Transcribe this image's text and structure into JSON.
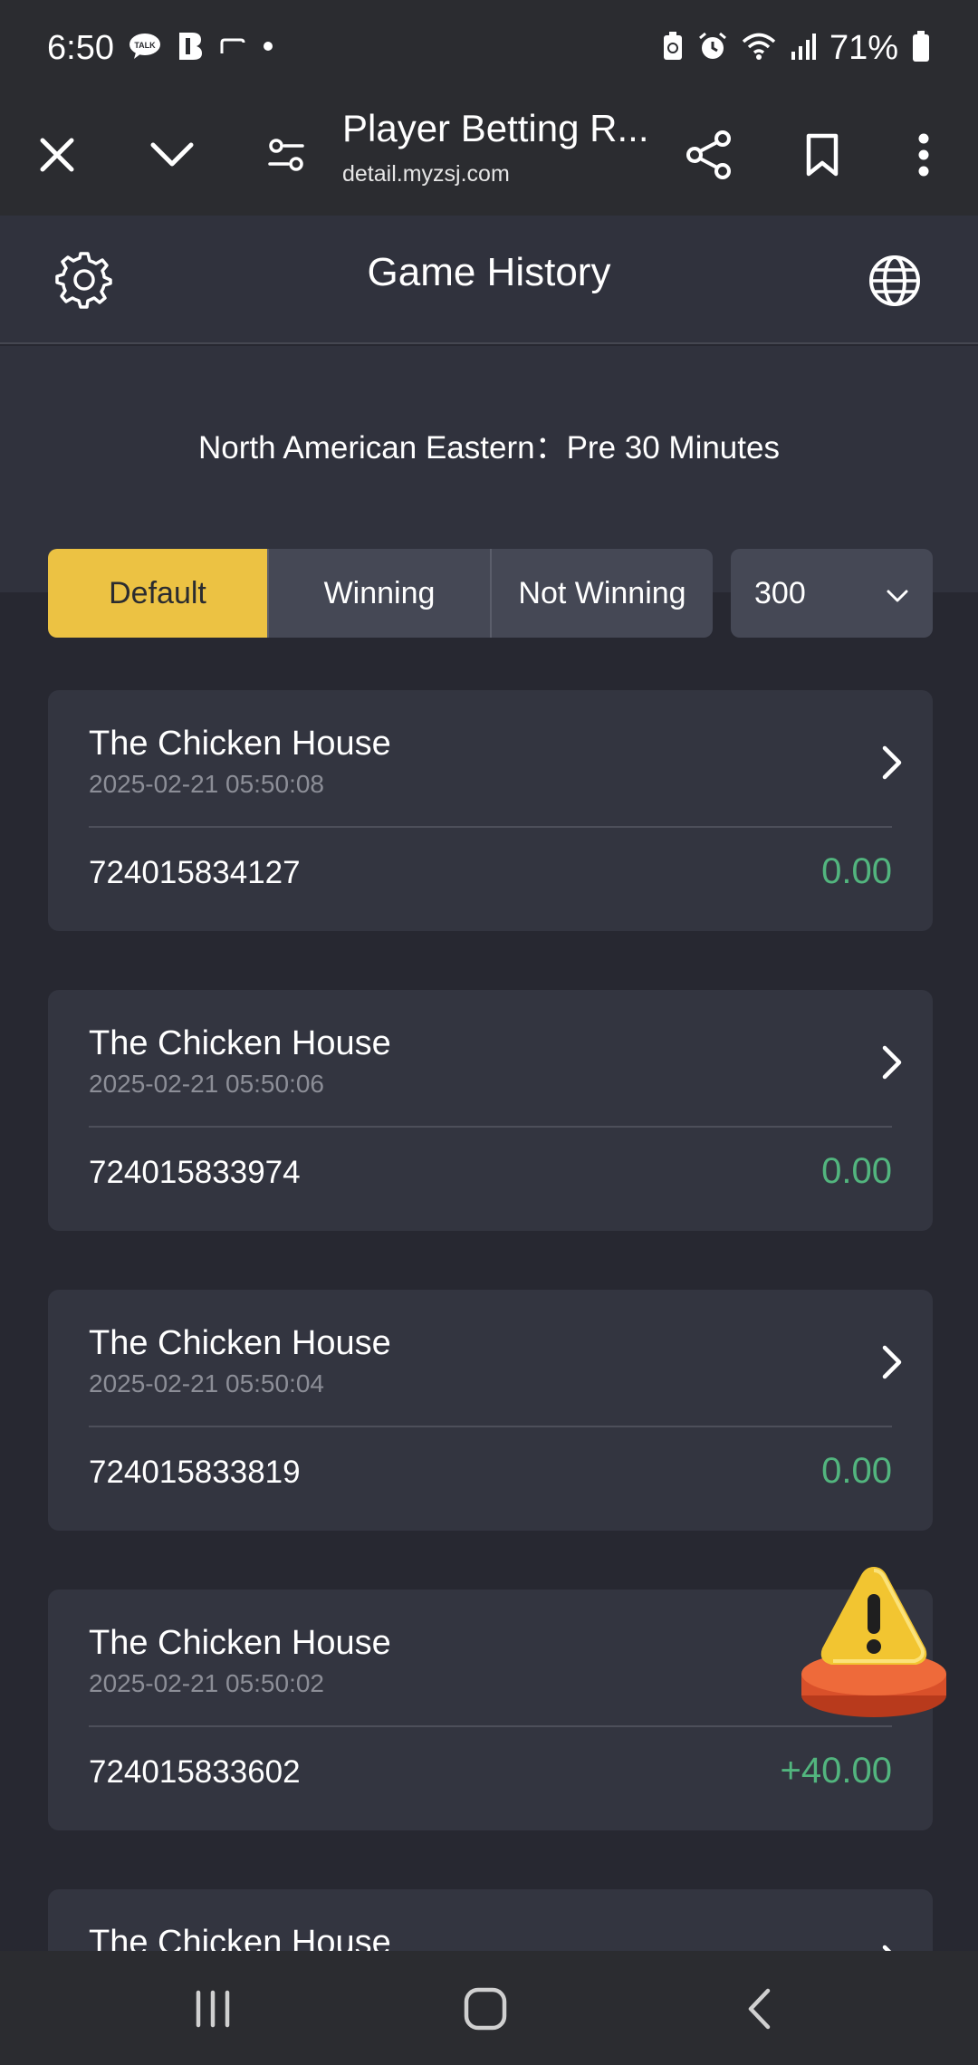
{
  "status_bar": {
    "time": "6:50",
    "battery": "71%",
    "icons": [
      "talk-icon",
      "b-app-icon",
      "cast-icon",
      "dot-icon",
      "battery-saver-icon",
      "alarm-icon",
      "wifi-icon",
      "signal-icon",
      "battery-icon"
    ]
  },
  "browser": {
    "title": "Player Betting R...",
    "url": "detail.myzsj.com",
    "icons": [
      "close-icon",
      "chevron-down-icon",
      "tune-icon",
      "share-icon",
      "bookmark-icon",
      "more-vert-icon"
    ]
  },
  "header": {
    "title": "Game History",
    "icons": [
      "gear-icon",
      "globe-icon"
    ]
  },
  "filter": {
    "timezone": "North American Eastern：Pre 30 Minutes",
    "tabs": [
      {
        "label": "Default",
        "active": true
      },
      {
        "label": "Winning",
        "active": false
      },
      {
        "label": "Not Winning",
        "active": false
      }
    ],
    "count_select": "300"
  },
  "records": [
    {
      "game": "The Chicken House",
      "time": "2025-02-21 05:50:08",
      "id": "724015834127",
      "amount": "0.00"
    },
    {
      "game": "The Chicken House",
      "time": "2025-02-21 05:50:06",
      "id": "724015833974",
      "amount": "0.00"
    },
    {
      "game": "The Chicken House",
      "time": "2025-02-21 05:50:04",
      "id": "724015833819",
      "amount": "0.00"
    },
    {
      "game": "The Chicken House",
      "time": "2025-02-21 05:50:02",
      "id": "724015833602",
      "amount": "+40.00"
    },
    {
      "game": "The Chicken House",
      "time": "",
      "id": "",
      "amount": ""
    }
  ],
  "colors": {
    "accent": "#ecc243",
    "positive": "#52b57e",
    "background": "#272831",
    "card": "#333540"
  }
}
